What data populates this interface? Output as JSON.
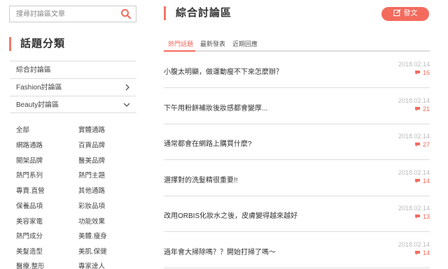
{
  "search": {
    "placeholder": "搜尋討論區文章",
    "icon": "search-icon"
  },
  "sidebar": {
    "title": "話題分類",
    "menu": [
      {
        "label": "綜合討論區",
        "chevron": ""
      },
      {
        "label": "Fashion討論區",
        "chevron": "›"
      },
      {
        "label": "Beauty討論區",
        "chevron": "⌄"
      }
    ],
    "tags": [
      "全部",
      "實體通路",
      "網路通路",
      "百貨品牌",
      "開架品牌",
      "醫美品牌",
      "熱門系列",
      "熱門主題",
      "專賣.直營",
      "其他通路",
      "保養品項",
      "彩妝品項",
      "美容家電",
      "功能效果",
      "熱門成分",
      "美體.瘦身",
      "美髮造型",
      "美肌.保健",
      "醫療.整形",
      "專家達人"
    ]
  },
  "main": {
    "title": "綜合討論區",
    "post_button": "發文",
    "tabs": [
      {
        "label": "熱門話題",
        "active": true
      },
      {
        "label": "最新發表",
        "active": false
      },
      {
        "label": "近期回應",
        "active": false
      }
    ],
    "posts": [
      {
        "title": "小腹太明顯，做運動瘦不下來怎麼辦？",
        "date": "2018.02.14",
        "comments": "16"
      },
      {
        "title": "下午用粉餅補妝後妝感都會變厚...",
        "date": "2018.02.14",
        "comments": "21"
      },
      {
        "title": "通常都會在網路上購買什麼?",
        "date": "2018.02.14",
        "comments": "27"
      },
      {
        "title": "選擇對的洗髮精很重要!!",
        "date": "2018.02.14",
        "comments": "14"
      },
      {
        "title": "改用ORBIS化妝水之後，皮膚變得越來越好",
        "date": "2018.02.14",
        "comments": "13"
      },
      {
        "title": "過年會大掃除嗎？？開始打掃了嗎～",
        "date": "2018.02.14",
        "comments": "14"
      }
    ]
  },
  "colors": {
    "accent": "#f36b5d",
    "divider": "#dddddd",
    "date": "#bbbbbb"
  }
}
